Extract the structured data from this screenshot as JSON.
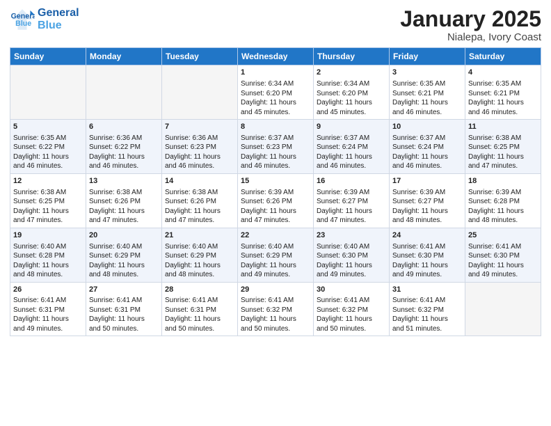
{
  "header": {
    "logo_line1": "General",
    "logo_line2": "Blue",
    "month": "January 2025",
    "location": "Nialepa, Ivory Coast"
  },
  "weekdays": [
    "Sunday",
    "Monday",
    "Tuesday",
    "Wednesday",
    "Thursday",
    "Friday",
    "Saturday"
  ],
  "weeks": [
    [
      {
        "day": "",
        "info": ""
      },
      {
        "day": "",
        "info": ""
      },
      {
        "day": "",
        "info": ""
      },
      {
        "day": "1",
        "info": "Sunrise: 6:34 AM\nSunset: 6:20 PM\nDaylight: 11 hours\nand 45 minutes."
      },
      {
        "day": "2",
        "info": "Sunrise: 6:34 AM\nSunset: 6:20 PM\nDaylight: 11 hours\nand 45 minutes."
      },
      {
        "day": "3",
        "info": "Sunrise: 6:35 AM\nSunset: 6:21 PM\nDaylight: 11 hours\nand 46 minutes."
      },
      {
        "day": "4",
        "info": "Sunrise: 6:35 AM\nSunset: 6:21 PM\nDaylight: 11 hours\nand 46 minutes."
      }
    ],
    [
      {
        "day": "5",
        "info": "Sunrise: 6:35 AM\nSunset: 6:22 PM\nDaylight: 11 hours\nand 46 minutes."
      },
      {
        "day": "6",
        "info": "Sunrise: 6:36 AM\nSunset: 6:22 PM\nDaylight: 11 hours\nand 46 minutes."
      },
      {
        "day": "7",
        "info": "Sunrise: 6:36 AM\nSunset: 6:23 PM\nDaylight: 11 hours\nand 46 minutes."
      },
      {
        "day": "8",
        "info": "Sunrise: 6:37 AM\nSunset: 6:23 PM\nDaylight: 11 hours\nand 46 minutes."
      },
      {
        "day": "9",
        "info": "Sunrise: 6:37 AM\nSunset: 6:24 PM\nDaylight: 11 hours\nand 46 minutes."
      },
      {
        "day": "10",
        "info": "Sunrise: 6:37 AM\nSunset: 6:24 PM\nDaylight: 11 hours\nand 46 minutes."
      },
      {
        "day": "11",
        "info": "Sunrise: 6:38 AM\nSunset: 6:25 PM\nDaylight: 11 hours\nand 47 minutes."
      }
    ],
    [
      {
        "day": "12",
        "info": "Sunrise: 6:38 AM\nSunset: 6:25 PM\nDaylight: 11 hours\nand 47 minutes."
      },
      {
        "day": "13",
        "info": "Sunrise: 6:38 AM\nSunset: 6:26 PM\nDaylight: 11 hours\nand 47 minutes."
      },
      {
        "day": "14",
        "info": "Sunrise: 6:38 AM\nSunset: 6:26 PM\nDaylight: 11 hours\nand 47 minutes."
      },
      {
        "day": "15",
        "info": "Sunrise: 6:39 AM\nSunset: 6:26 PM\nDaylight: 11 hours\nand 47 minutes."
      },
      {
        "day": "16",
        "info": "Sunrise: 6:39 AM\nSunset: 6:27 PM\nDaylight: 11 hours\nand 47 minutes."
      },
      {
        "day": "17",
        "info": "Sunrise: 6:39 AM\nSunset: 6:27 PM\nDaylight: 11 hours\nand 48 minutes."
      },
      {
        "day": "18",
        "info": "Sunrise: 6:39 AM\nSunset: 6:28 PM\nDaylight: 11 hours\nand 48 minutes."
      }
    ],
    [
      {
        "day": "19",
        "info": "Sunrise: 6:40 AM\nSunset: 6:28 PM\nDaylight: 11 hours\nand 48 minutes."
      },
      {
        "day": "20",
        "info": "Sunrise: 6:40 AM\nSunset: 6:29 PM\nDaylight: 11 hours\nand 48 minutes."
      },
      {
        "day": "21",
        "info": "Sunrise: 6:40 AM\nSunset: 6:29 PM\nDaylight: 11 hours\nand 48 minutes."
      },
      {
        "day": "22",
        "info": "Sunrise: 6:40 AM\nSunset: 6:29 PM\nDaylight: 11 hours\nand 49 minutes."
      },
      {
        "day": "23",
        "info": "Sunrise: 6:40 AM\nSunset: 6:30 PM\nDaylight: 11 hours\nand 49 minutes."
      },
      {
        "day": "24",
        "info": "Sunrise: 6:41 AM\nSunset: 6:30 PM\nDaylight: 11 hours\nand 49 minutes."
      },
      {
        "day": "25",
        "info": "Sunrise: 6:41 AM\nSunset: 6:30 PM\nDaylight: 11 hours\nand 49 minutes."
      }
    ],
    [
      {
        "day": "26",
        "info": "Sunrise: 6:41 AM\nSunset: 6:31 PM\nDaylight: 11 hours\nand 49 minutes."
      },
      {
        "day": "27",
        "info": "Sunrise: 6:41 AM\nSunset: 6:31 PM\nDaylight: 11 hours\nand 50 minutes."
      },
      {
        "day": "28",
        "info": "Sunrise: 6:41 AM\nSunset: 6:31 PM\nDaylight: 11 hours\nand 50 minutes."
      },
      {
        "day": "29",
        "info": "Sunrise: 6:41 AM\nSunset: 6:32 PM\nDaylight: 11 hours\nand 50 minutes."
      },
      {
        "day": "30",
        "info": "Sunrise: 6:41 AM\nSunset: 6:32 PM\nDaylight: 11 hours\nand 50 minutes."
      },
      {
        "day": "31",
        "info": "Sunrise: 6:41 AM\nSunset: 6:32 PM\nDaylight: 11 hours\nand 51 minutes."
      },
      {
        "day": "",
        "info": ""
      }
    ]
  ]
}
